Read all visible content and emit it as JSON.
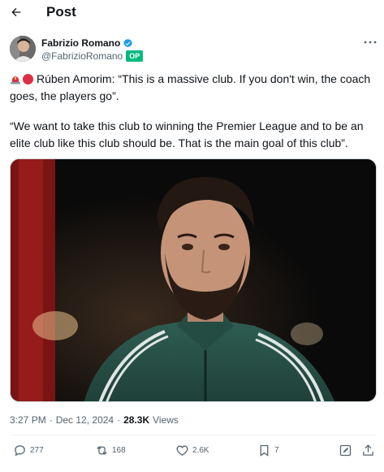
{
  "header": {
    "title": "Post"
  },
  "author": {
    "name": "Fabrizio Romano",
    "handle": "@FabrizioRomano",
    "badge": "OP"
  },
  "tweet": {
    "line1": "Rúben Amorim: “This is a massive club. If you don't win, the coach goes, the players go”.",
    "line2": "“We want to take this club to winning the Premier League and to be an elite club like this club should be. That is the main goal of this club”."
  },
  "meta": {
    "time": "3:27 PM",
    "separator": "·",
    "date": "Dec 12, 2024",
    "views_count": "28.3K",
    "views_label": "Views"
  },
  "actions": {
    "replies": "277",
    "reposts": "168",
    "likes": "2.6K",
    "bookmarks": "7"
  },
  "icons": {
    "back": "arrow-left-icon",
    "verified": "verified-badge-icon",
    "more": "more-icon",
    "reply": "reply-icon",
    "repost": "repost-icon",
    "like": "heart-icon",
    "bookmark": "bookmark-icon",
    "edit": "edit-icon",
    "share": "share-icon"
  },
  "colors": {
    "text": "#0f1419",
    "secondary": "#536471",
    "verified": "#1d9bf0",
    "op_badge": "#00ba7c",
    "divider": "#eff3f4"
  }
}
